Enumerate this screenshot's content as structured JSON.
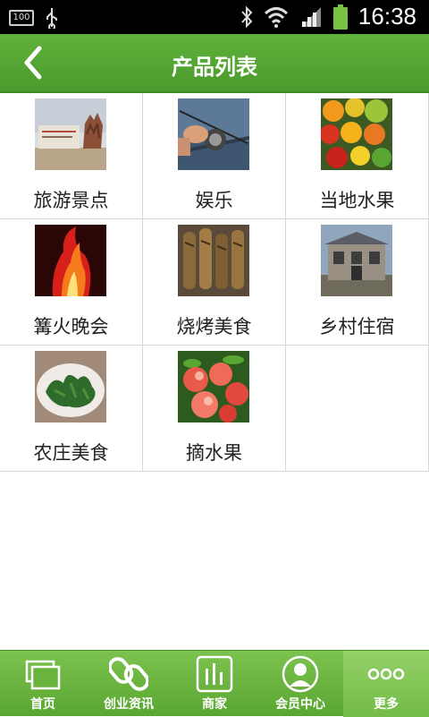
{
  "status_bar": {
    "battery_level": "100",
    "time": "16:38",
    "icons": [
      "battery-icon",
      "usb-icon",
      "bluetooth-icon",
      "wifi-icon",
      "signal-icon",
      "battery-charging-icon"
    ]
  },
  "header": {
    "title": "产品列表",
    "back_icon": "chevron-left-icon"
  },
  "products": [
    {
      "label": "旅游景点"
    },
    {
      "label": "娱乐"
    },
    {
      "label": "当地水果"
    },
    {
      "label": "篝火晚会"
    },
    {
      "label": "烧烤美食"
    },
    {
      "label": "乡村住宿"
    },
    {
      "label": "农庄美食"
    },
    {
      "label": "摘水果"
    }
  ],
  "tabs": [
    {
      "label": "首页",
      "icon": "pages-icon"
    },
    {
      "label": "创业资讯",
      "icon": "link-icon"
    },
    {
      "label": "商家",
      "icon": "bar-chart-icon"
    },
    {
      "label": "会员中心",
      "icon": "user-icon"
    },
    {
      "label": "更多",
      "icon": "more-icon"
    }
  ],
  "colors": {
    "accent": "#4fa22e",
    "tab_active": "#86c75a"
  }
}
